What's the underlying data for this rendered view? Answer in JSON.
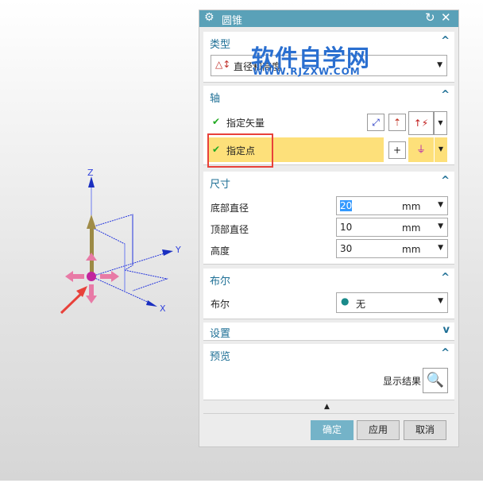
{
  "viewport": {
    "axis_labels": {
      "z": "Z",
      "y": "Y",
      "x": "X"
    }
  },
  "dialog": {
    "title": "圆锥",
    "sections": {
      "type": {
        "header": "类型",
        "value": "直径和高度"
      },
      "axis": {
        "header": "轴",
        "vector_label": "指定矢量",
        "point_label": "指定点"
      },
      "dimensions": {
        "header": "尺寸",
        "rows": [
          {
            "label": "底部直径",
            "value": "20",
            "unit": "mm"
          },
          {
            "label": "顶部直径",
            "value": "10",
            "unit": "mm"
          },
          {
            "label": "高度",
            "value": "30",
            "unit": "mm"
          }
        ]
      },
      "boolean": {
        "header": "布尔",
        "label": "布尔",
        "value": "无"
      },
      "settings": {
        "header": "设置"
      },
      "preview": {
        "header": "预览",
        "show_result": "显示结果"
      }
    },
    "buttons": {
      "ok": "确定",
      "apply": "应用",
      "cancel": "取消"
    }
  },
  "watermark": {
    "title": "软件自学网",
    "url": "WWW.RJZXW.COM"
  },
  "colors": {
    "title_bar": "#5aa1b8",
    "highlight": "#fde07a",
    "header_text": "#1e6f95",
    "annotation": "#e8413a"
  }
}
